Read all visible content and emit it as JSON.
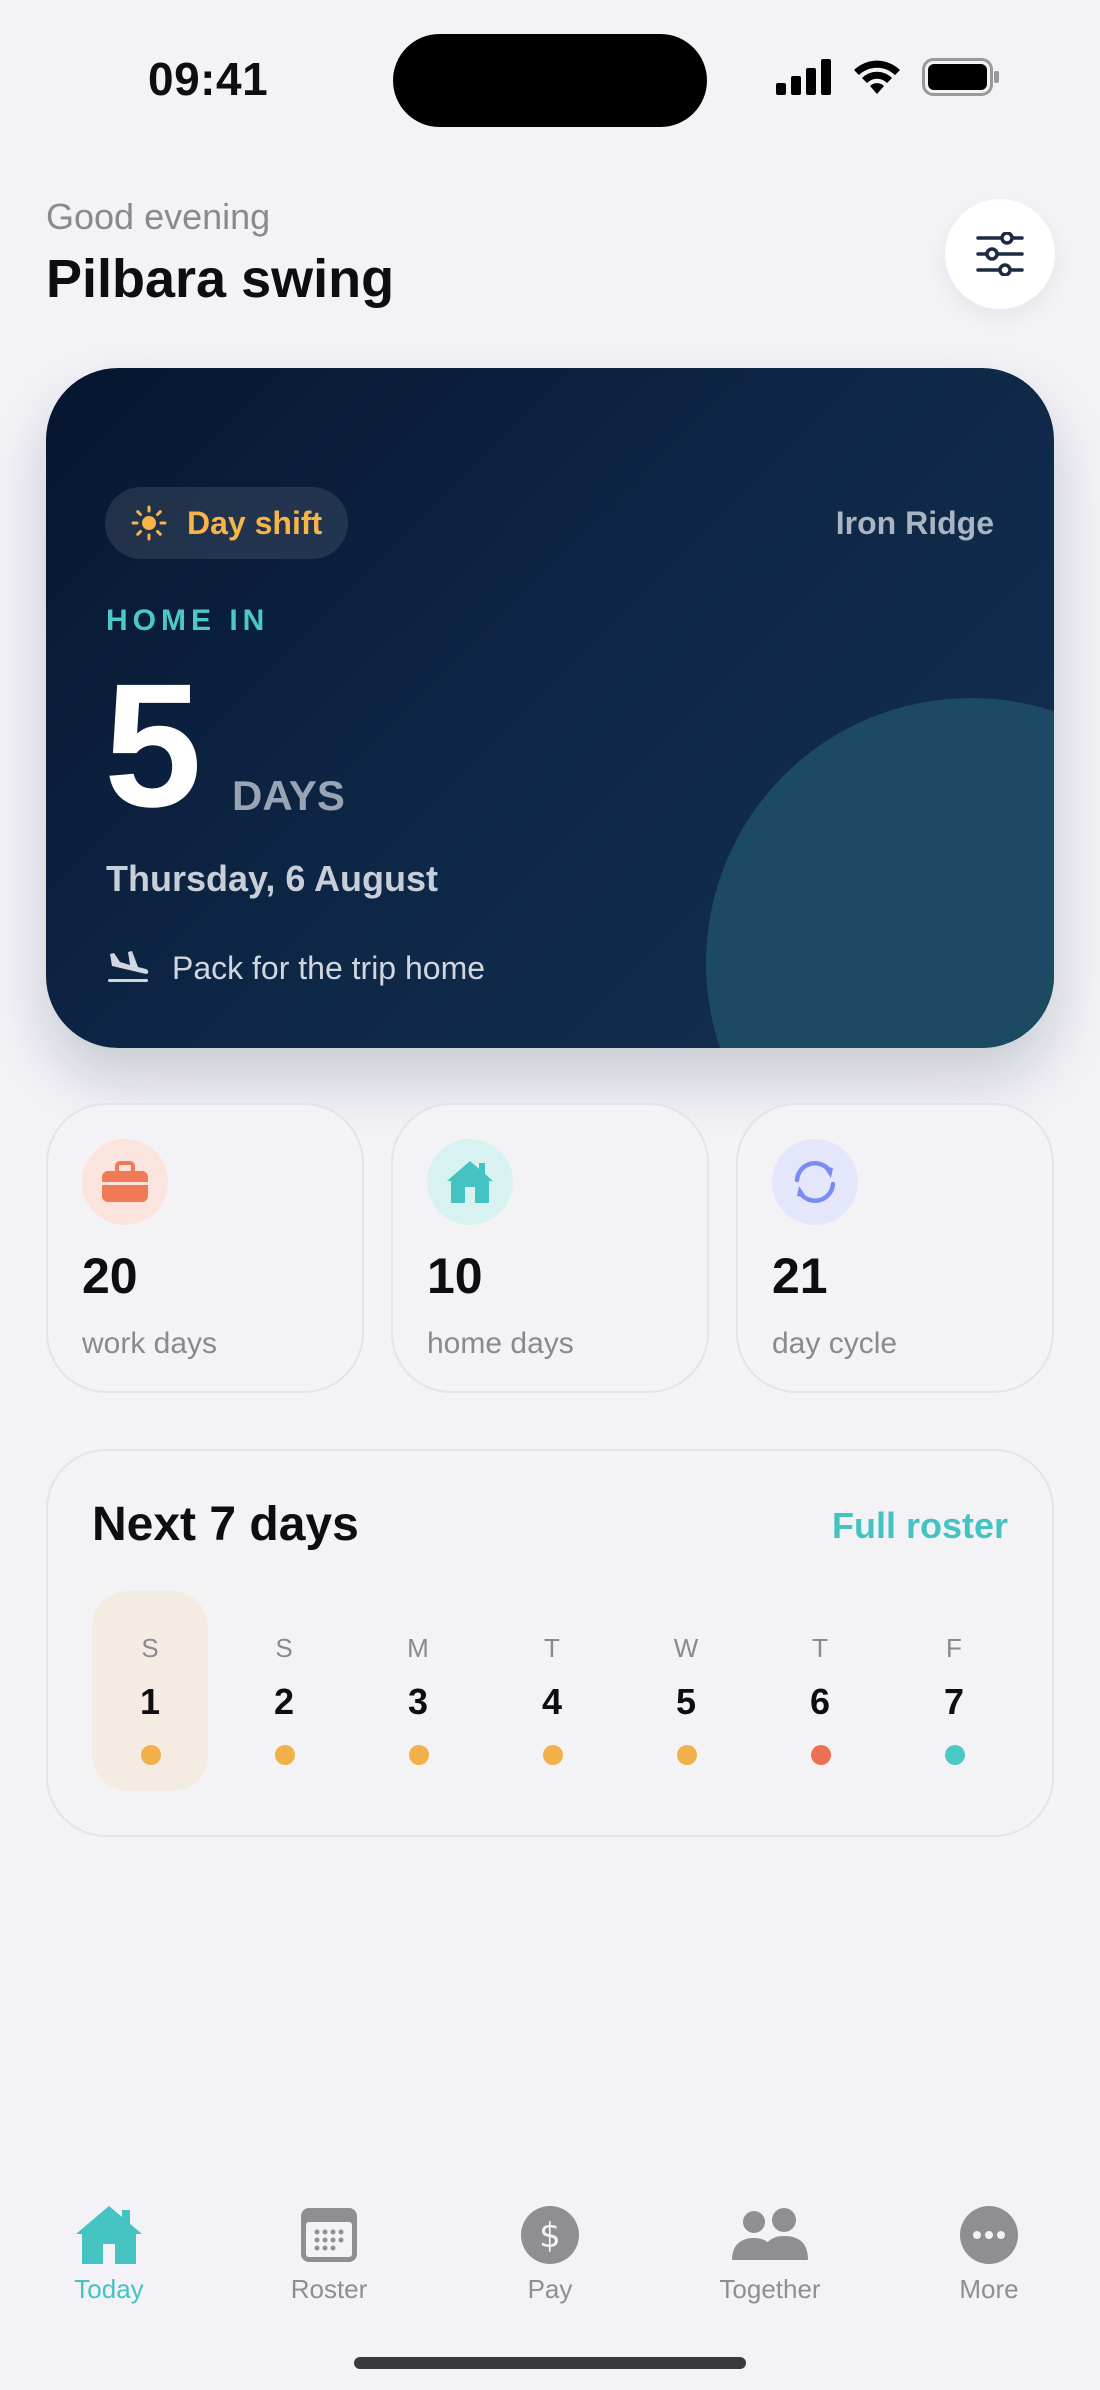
{
  "status_bar": {
    "time": "09:41"
  },
  "header": {
    "greeting": "Good evening",
    "title": "Pilbara swing"
  },
  "hero": {
    "shift_label": "Day shift",
    "site": "Iron Ridge",
    "home_in_label": "HOME IN",
    "days_count": "5",
    "days_unit": "DAYS",
    "date": "Thursday, 6 August",
    "note": "Pack for the trip home"
  },
  "stats": [
    {
      "value": "20",
      "label": "work days",
      "icon": "briefcase-icon"
    },
    {
      "value": "10",
      "label": "home days",
      "icon": "house-icon"
    },
    {
      "value": "21",
      "label": "day cycle",
      "icon": "cycle-icon"
    }
  ],
  "week": {
    "title": "Next 7 days",
    "link": "Full roster",
    "days": [
      {
        "letter": "S",
        "num": "1",
        "color": "#f2b04a",
        "today": true
      },
      {
        "letter": "S",
        "num": "2",
        "color": "#f2b04a"
      },
      {
        "letter": "M",
        "num": "3",
        "color": "#f2b04a"
      },
      {
        "letter": "T",
        "num": "4",
        "color": "#f2b04a"
      },
      {
        "letter": "W",
        "num": "5",
        "color": "#f2b04a"
      },
      {
        "letter": "T",
        "num": "6",
        "color": "#ee7052"
      },
      {
        "letter": "F",
        "num": "7",
        "color": "#4cc8c8"
      }
    ]
  },
  "tabs": [
    {
      "label": "Today",
      "icon": "house-icon",
      "active": true
    },
    {
      "label": "Roster",
      "icon": "calendar-icon"
    },
    {
      "label": "Pay",
      "icon": "dollar-icon"
    },
    {
      "label": "Together",
      "icon": "people-icon"
    },
    {
      "label": "More",
      "icon": "ellipsis-icon"
    }
  ],
  "colors": {
    "accent": "#45c2c2",
    "shift": "#f6b546",
    "work": "#f07a56",
    "home": "#45c2c2",
    "cycle": "#7b8cf0"
  }
}
